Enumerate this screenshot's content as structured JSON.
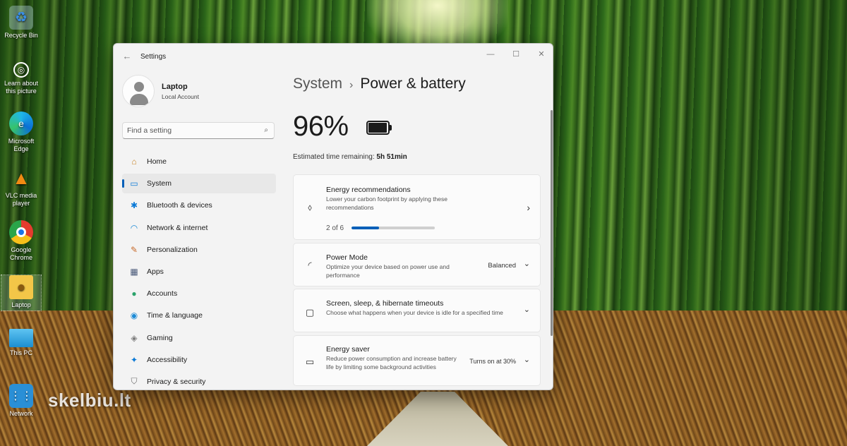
{
  "desktop": {
    "icons": [
      {
        "label": "Recycle Bin",
        "icon": "recycle-bin-icon"
      },
      {
        "label": "Learn about this picture",
        "icon": "camera-icon"
      },
      {
        "label": "Microsoft Edge",
        "icon": "edge-icon"
      },
      {
        "label": "VLC media player",
        "icon": "vlc-cone-icon"
      },
      {
        "label": "Google Chrome",
        "icon": "chrome-icon"
      },
      {
        "label": "Laptop",
        "icon": "user-folder-icon"
      },
      {
        "label": "This PC",
        "icon": "monitor-icon"
      },
      {
        "label": "Network",
        "icon": "network-icon"
      }
    ],
    "watermark": "skelbiu.lt"
  },
  "window": {
    "title": "Settings",
    "back": "←",
    "controls": {
      "minimize": "—",
      "maximize": "☐",
      "close": "✕"
    }
  },
  "profile": {
    "name": "Laptop",
    "subtitle": "Local Account"
  },
  "search": {
    "placeholder": "Find a setting",
    "icon": "⌕"
  },
  "nav": {
    "items": [
      {
        "label": "Home",
        "icon": "home-icon",
        "glyph": "⌂",
        "color": "#c8862a"
      },
      {
        "label": "System",
        "icon": "system-icon",
        "glyph": "▭",
        "color": "#0a79d6",
        "active": true
      },
      {
        "label": "Bluetooth & devices",
        "icon": "bluetooth-icon",
        "glyph": "✱",
        "color": "#0a79d6"
      },
      {
        "label": "Network & internet",
        "icon": "wifi-icon",
        "glyph": "◠",
        "color": "#1b8ad6"
      },
      {
        "label": "Personalization",
        "icon": "brush-icon",
        "glyph": "✎",
        "color": "#c86a2a"
      },
      {
        "label": "Apps",
        "icon": "apps-icon",
        "glyph": "▦",
        "color": "#4a5a7a"
      },
      {
        "label": "Accounts",
        "icon": "accounts-icon",
        "glyph": "●",
        "color": "#2ba36b"
      },
      {
        "label": "Time & language",
        "icon": "globe-clock-icon",
        "glyph": "◉",
        "color": "#1b8ad6"
      },
      {
        "label": "Gaming",
        "icon": "gamepad-icon",
        "glyph": "◈",
        "color": "#7a7a7a"
      },
      {
        "label": "Accessibility",
        "icon": "accessibility-icon",
        "glyph": "✦",
        "color": "#0a79d6"
      },
      {
        "label": "Privacy & security",
        "icon": "shield-icon",
        "glyph": "⛉",
        "color": "#6a6a6a"
      }
    ]
  },
  "breadcrumb": {
    "parent": "System",
    "separator": "›",
    "current": "Power & battery"
  },
  "battery": {
    "percent_text": "96%",
    "level": 0.96,
    "remaining_label": "Estimated time remaining:",
    "remaining_value": "5h 51min"
  },
  "cards": {
    "energy": {
      "title": "Energy recommendations",
      "description": "Lower your carbon footprint by applying these recommendations",
      "progress_text": "2 of 6",
      "progress": 0.333,
      "icon": "leaf-icon",
      "chevron": "›"
    },
    "power_mode": {
      "title": "Power Mode",
      "description": "Optimize your device based on power use and performance",
      "value": "Balanced",
      "icon": "power-mode-icon",
      "chevron": "⌄"
    },
    "timeouts": {
      "title": "Screen, sleep, & hibernate timeouts",
      "description": "Choose what happens when your device is idle for a specified time",
      "icon": "screen-sleep-icon",
      "chevron": "⌄"
    },
    "energy_saver": {
      "title": "Energy saver",
      "description": "Reduce power consumption and increase battery life by limiting some background activities",
      "value": "Turns on at 30%",
      "icon": "energy-saver-icon",
      "chevron": "⌄"
    }
  },
  "colors": {
    "accent": "#005fb8"
  }
}
